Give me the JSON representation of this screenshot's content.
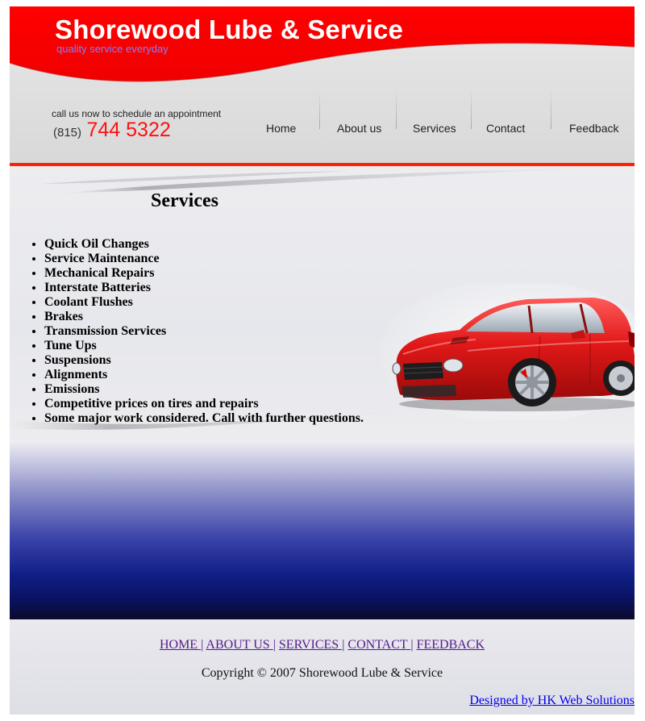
{
  "header": {
    "site_title": "Shorewood Lube & Service",
    "tagline": "quality service everyday",
    "call_text": "call us now to schedule an appointment",
    "area_code": "(815)",
    "phone_number": "744 5322"
  },
  "nav": {
    "items": [
      {
        "label": "Home"
      },
      {
        "label": "About us"
      },
      {
        "label": "Services"
      },
      {
        "label": "Contact"
      },
      {
        "label": "Feedback"
      }
    ]
  },
  "content": {
    "heading": "Services",
    "services": [
      "Quick Oil Changes",
      "Service Maintenance",
      "Mechanical Repairs",
      "Interstate Batteries",
      "Coolant Flushes",
      "Brakes",
      "Transmission Services",
      "Tune Ups",
      "Suspensions",
      "Alignments",
      "Emissions",
      "Competitive prices on tires and repairs",
      "Some major work considered. Call with further questions."
    ]
  },
  "footer": {
    "links": [
      "HOME ",
      "ABOUT US ",
      "SERVICES ",
      "CONTACT ",
      "FEEDBACK"
    ],
    "separator": "|",
    "copyright": "Copyright © 2007 Shorewood Lube & Service",
    "designer_link": "Designed by HK Web Solutions"
  },
  "colors": {
    "header_red": "#ff0000",
    "phone_red": "#ff1111",
    "tagline_blue": "#7f7fff",
    "visited_link": "#551a8b",
    "link_blue": "#0000ee",
    "band_navy": "#101f86"
  },
  "icons": {
    "car": "red-sports-car-image"
  }
}
